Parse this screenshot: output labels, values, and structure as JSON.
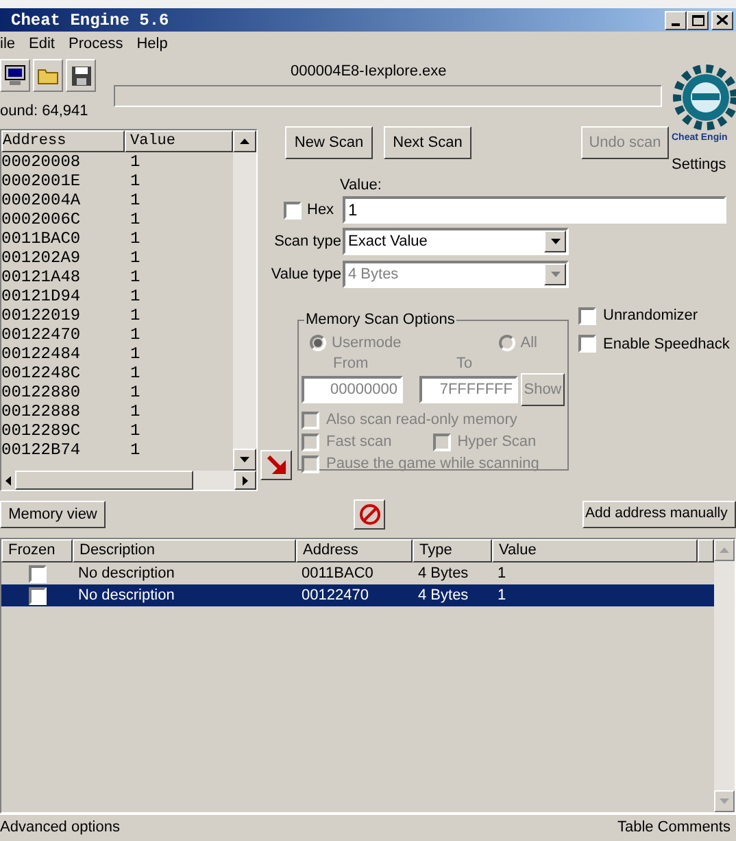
{
  "window": {
    "title": "Cheat Engine 5.6"
  },
  "menu": [
    "ile",
    "Edit",
    "Process",
    "Help"
  ],
  "process": {
    "name": "000004E8-Iexplore.exe",
    "level": 0
  },
  "found": "ound: 64,941",
  "results": {
    "columns": [
      "Address",
      "Value"
    ],
    "rows": [
      {
        "address": "00020008",
        "value": "1"
      },
      {
        "address": "0002001E",
        "value": "1"
      },
      {
        "address": "0002004A",
        "value": "1"
      },
      {
        "address": "0002006C",
        "value": "1"
      },
      {
        "address": "0011BAC0",
        "value": "1"
      },
      {
        "address": "001202A9",
        "value": "1"
      },
      {
        "address": "00121A48",
        "value": "1"
      },
      {
        "address": "00121D94",
        "value": "1"
      },
      {
        "address": "00122019",
        "value": "1"
      },
      {
        "address": "00122470",
        "value": "1"
      },
      {
        "address": "00122484",
        "value": "1"
      },
      {
        "address": "0012248C",
        "value": "1"
      },
      {
        "address": "00122880",
        "value": "1"
      },
      {
        "address": "00122888",
        "value": "1"
      },
      {
        "address": "0012289C",
        "value": "1"
      },
      {
        "address": "00122B74",
        "value": "1"
      }
    ]
  },
  "scan_buttons": [
    {
      "label": "New Scan",
      "disabled": false
    },
    {
      "label": "Next Scan",
      "disabled": false
    }
  ],
  "undo_button": {
    "label": "Undo scan",
    "disabled": true
  },
  "logo_caption": "Cheat Engin",
  "settings_label": "Settings",
  "value_field": {
    "label": "Value:",
    "value": "1"
  },
  "hex": {
    "label": "Hex",
    "checked": false
  },
  "scan_type": {
    "label": "Scan type",
    "value": "Exact Value",
    "disabled": false
  },
  "value_type": {
    "label": "Value type",
    "value": "4 Bytes",
    "disabled": true
  },
  "memory_scan_options": {
    "title": "Memory Scan Options",
    "disabled": true,
    "radios": [
      {
        "label": "Usermode",
        "selected": true
      },
      {
        "label": "All",
        "selected": false
      }
    ],
    "from": {
      "label": "From",
      "value": "00000000"
    },
    "to": {
      "label": "To",
      "value": "7FFFFFFF"
    },
    "show_button": "Show",
    "checkboxes": [
      {
        "label": "Also scan read-only memory",
        "checked": false
      },
      {
        "label": "Fast scan",
        "checked": false
      },
      {
        "label": "Hyper Scan",
        "checked": false
      },
      {
        "label": "Pause the game while scanning",
        "checked": false
      }
    ]
  },
  "options": [
    {
      "label": "Unrandomizer",
      "checked": false
    },
    {
      "label": "Enable Speedhack",
      "checked": false
    }
  ],
  "memory_view_button": "Memory view",
  "add_address_button": "Add address manually",
  "address_table": {
    "columns": [
      "Frozen",
      "Description",
      "Address",
      "Type",
      "Value"
    ],
    "rows": [
      {
        "frozen": false,
        "description": "No description",
        "address": "0011BAC0",
        "type": "4 Bytes",
        "value": "1",
        "selected": false
      },
      {
        "frozen": false,
        "description": "No description",
        "address": "00122470",
        "type": "4 Bytes",
        "value": "1",
        "selected": true
      }
    ]
  },
  "status_bar": {
    "left": "Advanced options",
    "right": "Table Comments"
  }
}
